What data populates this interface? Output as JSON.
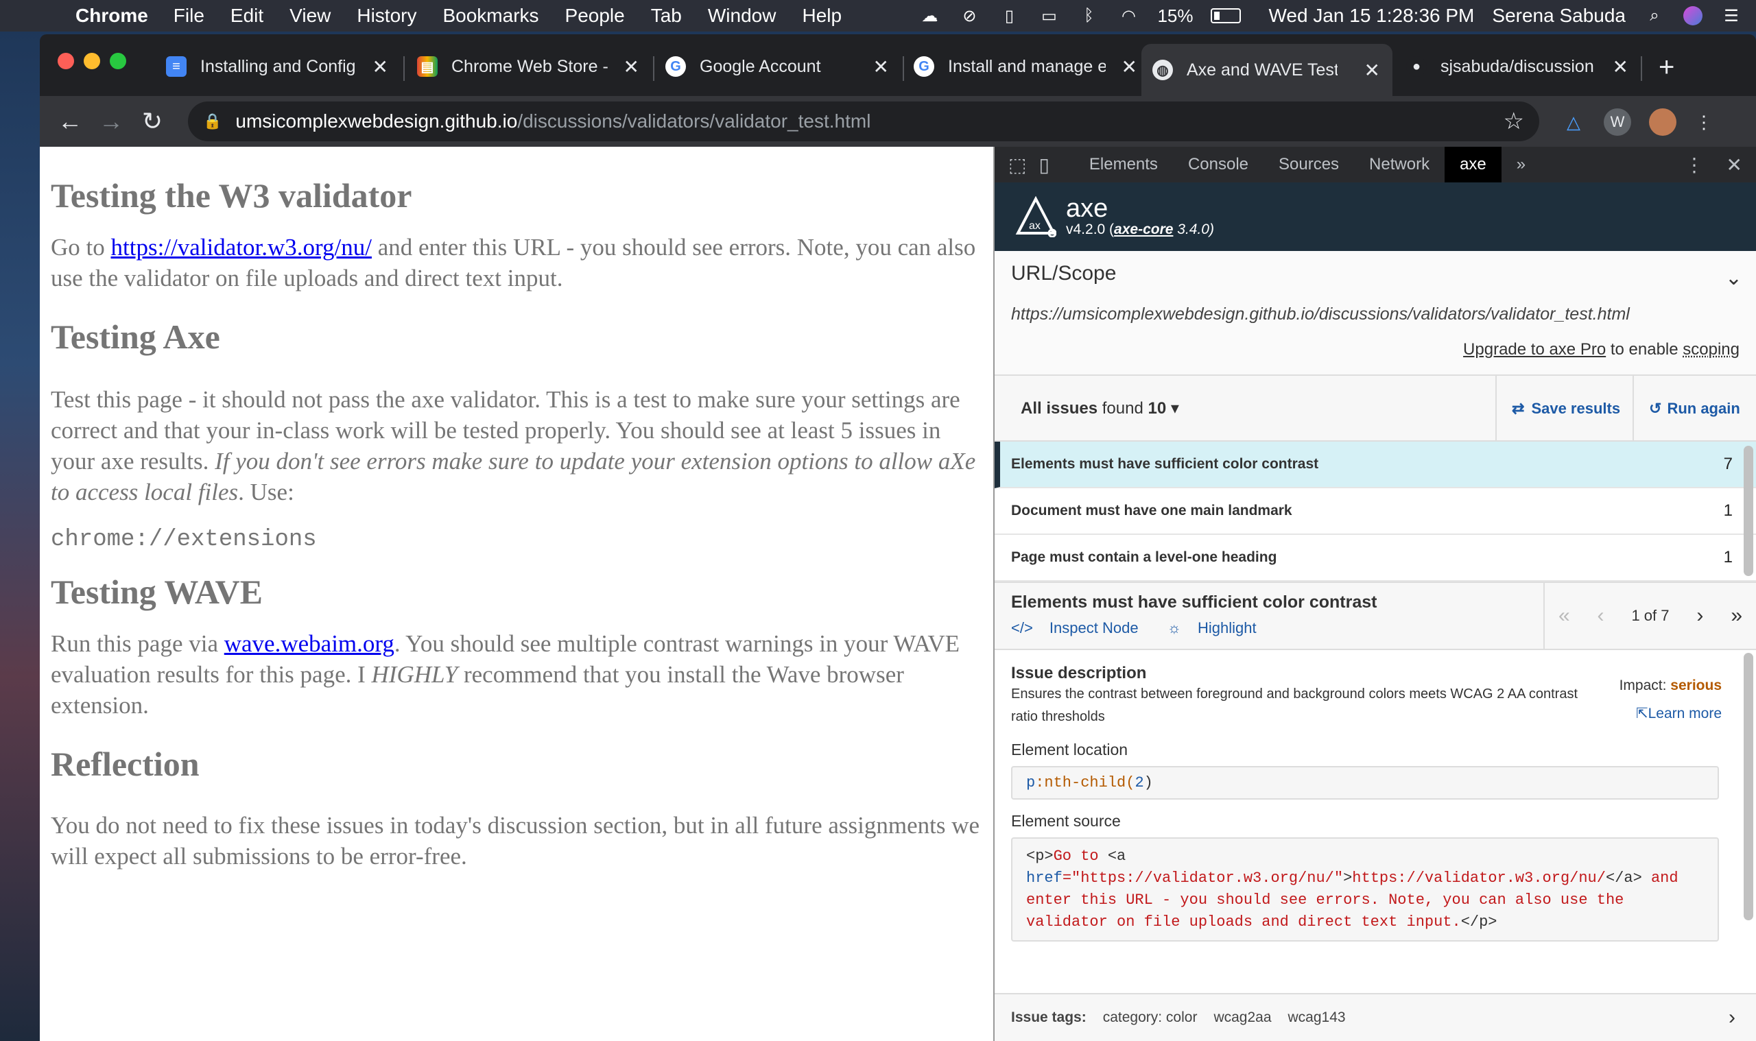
{
  "menubar": {
    "app": "Chrome",
    "items": [
      "File",
      "Edit",
      "View",
      "History",
      "Bookmarks",
      "People",
      "Tab",
      "Window",
      "Help"
    ],
    "battery": "15%",
    "datetime": "Wed Jan 15  1:28:36 PM",
    "user": "Serena Sabuda"
  },
  "tabs": [
    {
      "title": "Installing and Config",
      "favicon": "docs-icon"
    },
    {
      "title": "Chrome Web Store -",
      "favicon": "webstore-icon"
    },
    {
      "title": "Google Account",
      "favicon": "google-icon"
    },
    {
      "title": "Install and manage e",
      "favicon": "google-icon"
    },
    {
      "title": "Axe and WAVE Test P",
      "favicon": "globe-icon",
      "active": true
    },
    {
      "title": "sjsabuda/discussion",
      "favicon": "github-icon"
    }
  ],
  "address": {
    "host": "umsicomplexwebdesign.github.io",
    "path": "/discussions/validators/validator_test.html"
  },
  "page": {
    "h1": "Testing the W3 validator",
    "p1_pre": "Go to ",
    "p1_link": "https://validator.w3.org/nu/",
    "p1_post": " and enter this URL - you should see errors. Note, you can also use the validator on file uploads and direct text input.",
    "h2": "Testing Axe",
    "p2_pre": "Test this page - it should not pass the axe validator. This is a test to make sure your settings are correct and that your in-class work will be tested properly. You should see at least 5 issues in your axe results. ",
    "p2_em": "If you don't see errors make sure to update your extension options to allow aXe to access local files",
    "p2_post": ". Use:",
    "code": "chrome://extensions",
    "h3": "Testing WAVE",
    "p3_pre": "Run this page via ",
    "p3_link": "wave.webaim.org",
    "p3_mid": ". You should see multiple contrast warnings in your WAVE evaluation results for this page. I ",
    "p3_em": "HIGHLY",
    "p3_post": " recommend that you install the Wave browser extension.",
    "h4": "Reflection",
    "p4": "You do not need to fix these issues in today's discussion section, but in all future assignments we will expect all submissions to be error-free."
  },
  "devtools": {
    "tabs": [
      "Elements",
      "Console",
      "Sources",
      "Network",
      "axe"
    ],
    "more": "»"
  },
  "axe": {
    "name": "axe",
    "version_pre": "v4.2.0 (",
    "version_core": "axe-core",
    "version_post": " 3.4.0)",
    "scope_title": "URL/Scope",
    "scope_url": "https://umsicomplexwebdesign.github.io/discussions/validators/validator_test.html",
    "upgrade_link": "Upgrade to axe Pro",
    "upgrade_mid": " to enable ",
    "upgrade_scoping": "scoping",
    "issues_label": "All issues",
    "issues_found": " found ",
    "issues_count": "10",
    "save_label": "Save results",
    "run_label": "Run again",
    "issues": [
      {
        "title": "Elements must have sufficient color contrast",
        "count": "7"
      },
      {
        "title": "Document must have one main landmark",
        "count": "1"
      },
      {
        "title": "Page must contain a level-one heading",
        "count": "1"
      }
    ],
    "detail": {
      "title": "Elements must have sufficient color contrast",
      "inspect": "Inspect Node",
      "highlight": "Highlight",
      "pager": "1 of 7",
      "desc_title": "Issue description",
      "desc": "Ensures the contrast between foreground and background colors meets WCAG 2 AA contrast ratio thresholds",
      "impact_label": "Impact: ",
      "impact_value": "serious",
      "learn_more": "Learn more",
      "location_title": "Element location",
      "location_pre": "p",
      "location_sel": ":nth-child(",
      "location_num": "2",
      "location_post": ")",
      "source_title": "Element source",
      "source_line1_a": "<p>",
      "source_line1_b": "Go to ",
      "source_line1_c": "<a",
      "source_line2_attr": "href",
      "source_line2_val": "=\"https://validator.w3.org/nu/\"",
      "source_line2_b": ">",
      "source_line2_text": "https://validator.w3.org/nu/",
      "source_line2_c": "</a>",
      "source_line2_d": " and",
      "source_line3": "enter this URL - you should see errors. Note, you can also use the",
      "source_line4": "validator on file uploads and direct text input.",
      "source_line4_end": "</p>",
      "tags_label": "Issue tags:",
      "tags": [
        "category: color",
        "wcag2aa",
        "wcag143"
      ]
    }
  },
  "colors": {
    "axe_dark": "#1e2f3c",
    "link_blue": "#1d5aa6",
    "serious": "#b45a00",
    "selected_row": "#d6f1f6"
  }
}
